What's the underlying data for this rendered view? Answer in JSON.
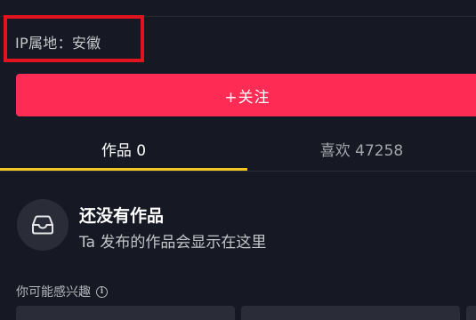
{
  "profile": {
    "ip_location": "IP属地：安徽",
    "follow_label": "+关注"
  },
  "tabs": [
    {
      "label": "作品 0",
      "active": true
    },
    {
      "label": "喜欢 47258",
      "active": false
    }
  ],
  "empty_state": {
    "icon": "inbox-icon",
    "title": "还没有作品",
    "subtitle": "Ta 发布的作品会显示在这里"
  },
  "recommendations": {
    "label": "你可能感兴趣",
    "info_icon": "info-icon"
  },
  "colors": {
    "background": "#161823",
    "accent": "#fe2c55",
    "tab_indicator": "#f3c623",
    "highlight_box": "#e0141e"
  }
}
